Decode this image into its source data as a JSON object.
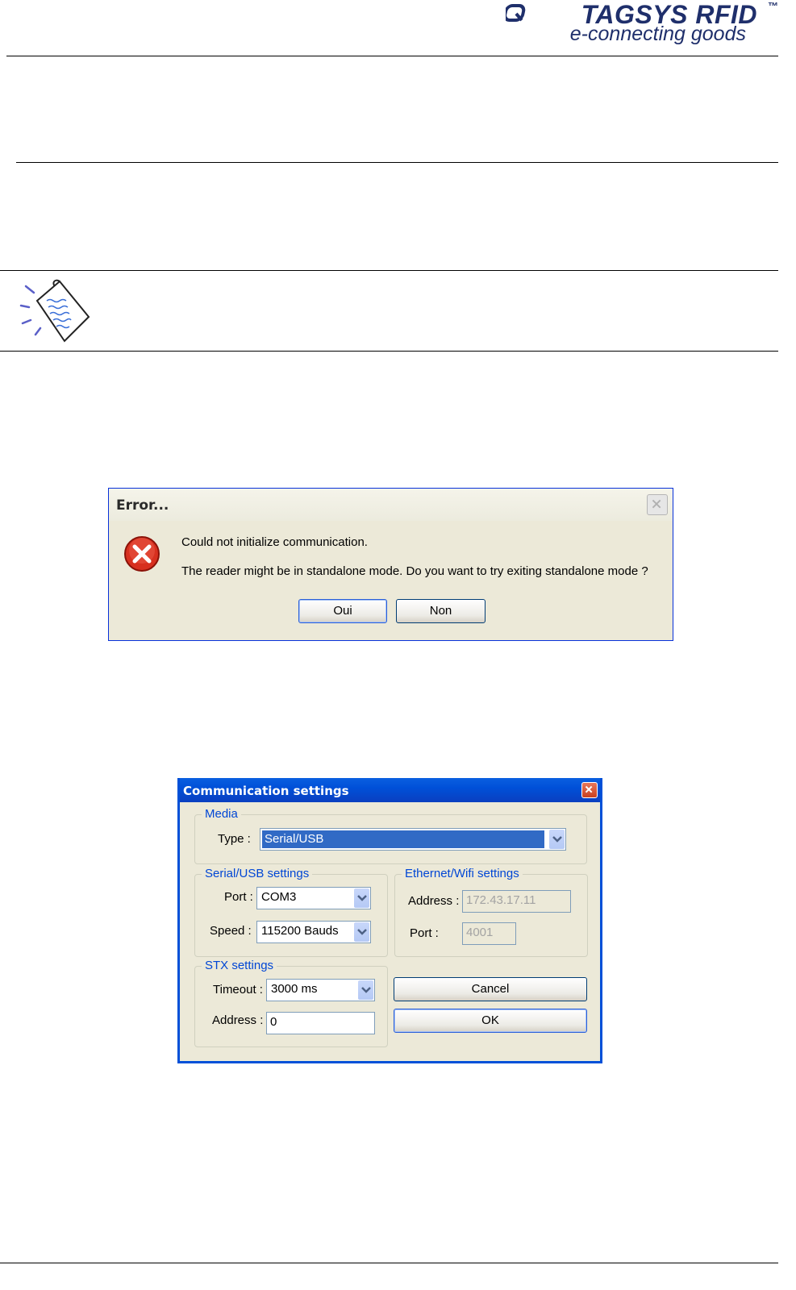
{
  "header": {
    "brand": "TAGSYS RFID",
    "trademark": "™",
    "tagline": "e-connecting goods"
  },
  "icons": {
    "logo": "tagsys-logo-mark",
    "note": "note-paper-icon",
    "error": "error-x-icon",
    "close": "close-icon",
    "dropdown": "chevron-down-icon"
  },
  "error_dialog": {
    "title": "Error...",
    "message_line1": "Could not initialize communication.",
    "message_line2": "The reader might be in standalone mode. Do you want to try exiting standalone mode ?",
    "yes_label": "Oui",
    "no_label": "Non"
  },
  "comm_dialog": {
    "title": "Communication settings",
    "media": {
      "legend": "Media",
      "type_label": "Type :",
      "type_value": "Serial/USB"
    },
    "serial": {
      "legend": "Serial/USB settings",
      "port_label": "Port :",
      "port_value": "COM3",
      "speed_label": "Speed :",
      "speed_value": "115200 Bauds"
    },
    "ethernet": {
      "legend": "Ethernet/Wifi settings",
      "address_label": "Address :",
      "address_value": "172.43.17.11",
      "port_label": "Port :",
      "port_value": "4001"
    },
    "stx": {
      "legend": "STX settings",
      "timeout_label": "Timeout :",
      "timeout_value": "3000 ms",
      "address_label": "Address :",
      "address_value": "0"
    },
    "cancel_label": "Cancel",
    "ok_label": "OK"
  },
  "colors": {
    "brand": "#1f2f6b",
    "title_bar": "#0050d8",
    "dialog_bg": "#ece9d8",
    "legend": "#0046d5"
  }
}
